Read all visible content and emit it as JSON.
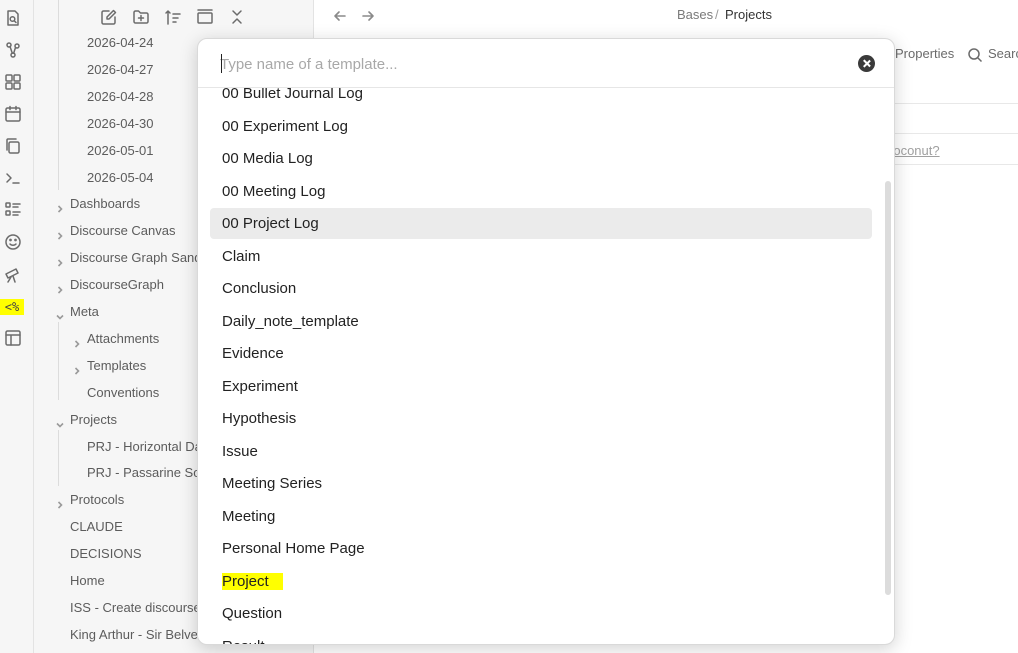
{
  "ribbon": {
    "icons": [
      "quick-switcher-icon",
      "graph-view-icon",
      "canvas-icon",
      "daily-note-icon",
      "copy-icon",
      "terminal-icon",
      "list-icon",
      "emoji-icon",
      "telescope-icon",
      "templater-icon",
      "layout-icon"
    ],
    "templater_label": "<%"
  },
  "sidebar": {
    "toolbar_icons": [
      "new-note-icon",
      "new-folder-icon",
      "sort-icon",
      "collapse-icon",
      "close-icon"
    ],
    "items": [
      {
        "label": "2026-04-24",
        "level": 2,
        "folder": false
      },
      {
        "label": "2026-04-27",
        "level": 2,
        "folder": false
      },
      {
        "label": "2026-04-28",
        "level": 2,
        "folder": false
      },
      {
        "label": "2026-04-30",
        "level": 2,
        "folder": false
      },
      {
        "label": "2026-05-01",
        "level": 2,
        "folder": false
      },
      {
        "label": "2026-05-04",
        "level": 2,
        "folder": false
      },
      {
        "label": "Dashboards",
        "level": 1,
        "folder": true,
        "open": false
      },
      {
        "label": "Discourse Canvas",
        "level": 1,
        "folder": true,
        "open": false
      },
      {
        "label": "Discourse Graph Sand",
        "level": 1,
        "folder": true,
        "open": false
      },
      {
        "label": "DiscourseGraph",
        "level": 1,
        "folder": true,
        "open": false
      },
      {
        "label": "Meta",
        "level": 1,
        "folder": true,
        "open": true
      },
      {
        "label": "Attachments",
        "level": 2,
        "folder": true,
        "open": false
      },
      {
        "label": "Templates",
        "level": 2,
        "folder": true,
        "open": false
      },
      {
        "label": "Conventions",
        "level": 2,
        "folder": false
      },
      {
        "label": "Projects",
        "level": 1,
        "folder": true,
        "open": true
      },
      {
        "label": "PRJ - Horizontal Da",
        "level": 2,
        "folder": false
      },
      {
        "label": "PRJ - Passarine Son",
        "level": 2,
        "folder": false
      },
      {
        "label": "Protocols",
        "level": 1,
        "folder": true,
        "open": false
      },
      {
        "label": "CLAUDE",
        "level": 1,
        "folder": false
      },
      {
        "label": "DECISIONS",
        "level": 1,
        "folder": false
      },
      {
        "label": "Home",
        "level": 1,
        "folder": false
      },
      {
        "label": "ISS - Create discourse",
        "level": 1,
        "folder": false
      },
      {
        "label": "King Arthur - Sir Belve",
        "level": 1,
        "folder": false
      }
    ]
  },
  "main": {
    "breadcrumb": {
      "parent": "Bases",
      "separator": "/",
      "current": "Projects"
    },
    "properties_label": "Properties",
    "search_label": "Search",
    "background_link": "d coconut?"
  },
  "modal": {
    "placeholder": "Type name of a template...",
    "value": "",
    "results": [
      {
        "label": "00 Bullet Journal Log",
        "selected": false,
        "highlighted": false
      },
      {
        "label": "00 Experiment Log",
        "selected": false,
        "highlighted": false
      },
      {
        "label": "00 Media Log",
        "selected": false,
        "highlighted": false
      },
      {
        "label": "00 Meeting Log",
        "selected": false,
        "highlighted": false
      },
      {
        "label": "00 Project Log",
        "selected": true,
        "highlighted": false
      },
      {
        "label": "Claim",
        "selected": false,
        "highlighted": false
      },
      {
        "label": "Conclusion",
        "selected": false,
        "highlighted": false
      },
      {
        "label": "Daily_note_template",
        "selected": false,
        "highlighted": false
      },
      {
        "label": "Evidence",
        "selected": false,
        "highlighted": false
      },
      {
        "label": "Experiment",
        "selected": false,
        "highlighted": false
      },
      {
        "label": "Hypothesis",
        "selected": false,
        "highlighted": false
      },
      {
        "label": "Issue",
        "selected": false,
        "highlighted": false
      },
      {
        "label": "Meeting Series",
        "selected": false,
        "highlighted": false
      },
      {
        "label": "Meeting",
        "selected": false,
        "highlighted": false
      },
      {
        "label": "Personal Home Page",
        "selected": false,
        "highlighted": false
      },
      {
        "label": "Project",
        "selected": false,
        "highlighted": true
      },
      {
        "label": "Question",
        "selected": false,
        "highlighted": false
      },
      {
        "label": "Result",
        "selected": false,
        "highlighted": false
      }
    ]
  },
  "colors": {
    "highlight": "#ffff00",
    "selected_row": "#ebebeb",
    "sidebar_bg": "#f6f6f6"
  }
}
